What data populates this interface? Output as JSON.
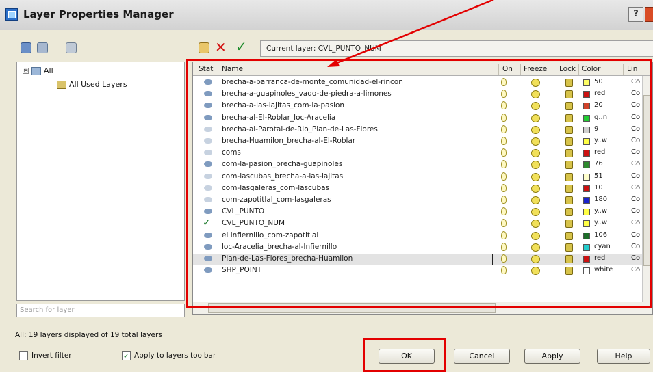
{
  "window": {
    "title": "Layer Properties Manager",
    "help_label": "?"
  },
  "toolbar": {
    "current_layer_text": "Current layer: CVL_PUNTO_NUM"
  },
  "filter_tree": {
    "root_label": "All",
    "child_label": "All Used Layers",
    "expander": "⊟"
  },
  "search": {
    "placeholder": "Search for layer"
  },
  "grid": {
    "columns": [
      "Stat",
      "Name",
      "On",
      "Freeze",
      "Lock",
      "Color",
      "Lin"
    ],
    "rows": [
      {
        "name": "brecha-a-barranca-de-monte_comunidad-el-rincon",
        "color_name": "50",
        "color": "#ffff66",
        "linetype": "Co",
        "status": "layer"
      },
      {
        "name": "brecha-a-guapinoles_vado-de-piedra-a-limones",
        "color_name": "red",
        "color": "#cc1111",
        "linetype": "Co",
        "status": "layer"
      },
      {
        "name": "brecha-a-las-lajitas_com-la-pasion",
        "color_name": "20",
        "color": "#d0422a",
        "linetype": "Co",
        "status": "layer"
      },
      {
        "name": "brecha-al-El-Roblar_loc-Aracelia",
        "color_name": "g..n",
        "color": "#22cc33",
        "linetype": "Co",
        "status": "layer"
      },
      {
        "name": "brecha-al-Parotal-de-Rio_Plan-de-Las-Flores",
        "color_name": "9",
        "color": "#cfcfcf",
        "linetype": "Co",
        "status": "faint"
      },
      {
        "name": "brecha-Huamilon_brecha-al-El-Roblar",
        "color_name": "y..w",
        "color": "#ffff44",
        "linetype": "Co",
        "status": "faint"
      },
      {
        "name": "coms",
        "color_name": "red",
        "color": "#cc1111",
        "linetype": "Co",
        "status": "faint"
      },
      {
        "name": "com-la-pasion_brecha-guapinoles",
        "color_name": "76",
        "color": "#2e8a2e",
        "linetype": "Co",
        "status": "layer"
      },
      {
        "name": "com-lascubas_brecha-a-las-lajitas",
        "color_name": "51",
        "color": "#ffffcc",
        "linetype": "Co",
        "status": "faint"
      },
      {
        "name": "com-lasgaleras_com-lascubas",
        "color_name": "10",
        "color": "#cc1111",
        "linetype": "Co",
        "status": "faint"
      },
      {
        "name": "com-zapotitlal_com-lasgaleras",
        "color_name": "180",
        "color": "#1a22cc",
        "linetype": "Co",
        "status": "faint"
      },
      {
        "name": "CVL_PUNTO",
        "color_name": "y..w",
        "color": "#ffff44",
        "linetype": "Co",
        "status": "layer"
      },
      {
        "name": "CVL_PUNTO_NUM",
        "color_name": "y..w",
        "color": "#ffff44",
        "linetype": "Co",
        "status": "current"
      },
      {
        "name": "el infiernillo_com-zapotitlal",
        "color_name": "106",
        "color": "#1e6e2a",
        "linetype": "Co",
        "status": "layer"
      },
      {
        "name": "loc-Aracelia_brecha-al-Infiernillo",
        "color_name": "cyan",
        "color": "#22cccc",
        "linetype": "Co",
        "status": "layer"
      },
      {
        "name": "Plan-de-Las-Flores_brecha-Huamilon",
        "color_name": "red",
        "color": "#cc1111",
        "linetype": "Co",
        "status": "selected"
      },
      {
        "name": "SHP_POINT",
        "color_name": "white",
        "color": "#ffffff",
        "linetype": "Co",
        "status": "layer"
      }
    ]
  },
  "status_bar": {
    "text": "All: 19 layers displayed of 19 total layers"
  },
  "options": {
    "invert_filter_label": "Invert filter",
    "invert_filter_checked": false,
    "apply_toolbar_label": "Apply to layers toolbar",
    "apply_toolbar_checked": true,
    "check_glyph": "✓"
  },
  "buttons": {
    "ok": "OK",
    "cancel": "Cancel",
    "apply": "Apply",
    "help": "Help"
  },
  "annotation": {
    "color": "#e30000"
  }
}
